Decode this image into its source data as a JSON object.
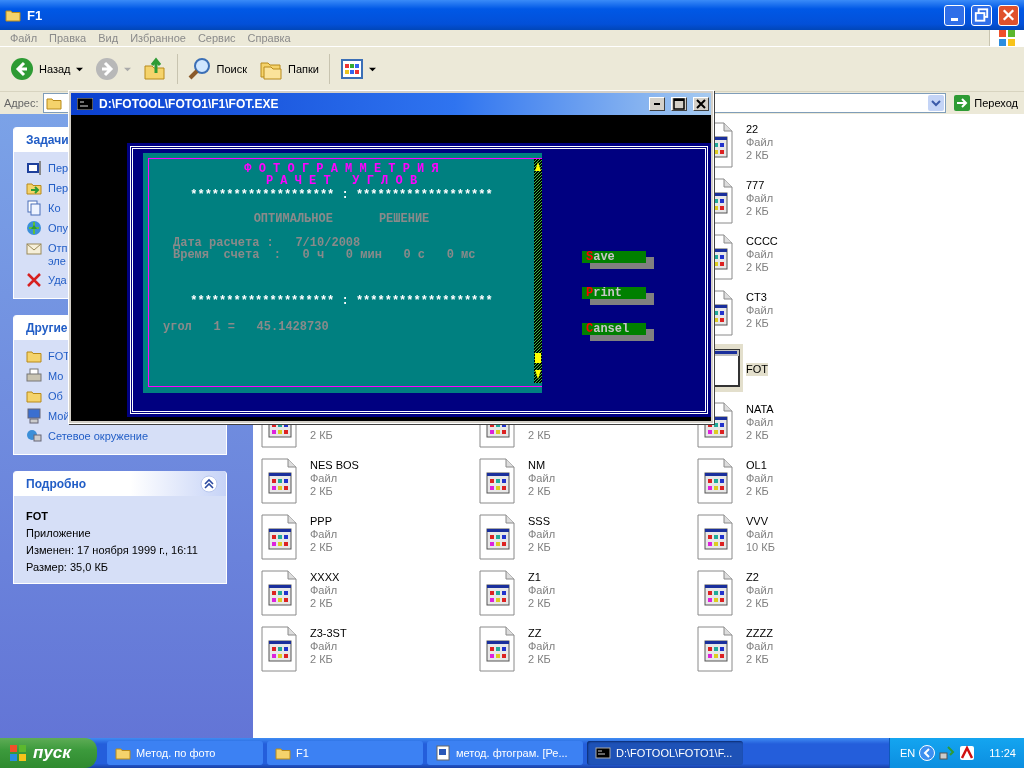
{
  "window": {
    "title": "F1"
  },
  "menu": [
    "Файл",
    "Правка",
    "Вид",
    "Избранное",
    "Сервис",
    "Справка"
  ],
  "toolbar": [
    {
      "kind": "back",
      "label": "Назад",
      "disabled": false
    },
    {
      "kind": "forward",
      "disabled": true
    },
    {
      "kind": "up"
    },
    {
      "kind": "search",
      "label": "Поиск"
    },
    {
      "kind": "folders",
      "label": "Папки"
    },
    {
      "kind": "views"
    }
  ],
  "address": {
    "label": "Адрес:",
    "go": "Переход"
  },
  "sidebar": {
    "panels": [
      {
        "kind": "list",
        "title": "Задачи",
        "items": [
          {
            "kind": "window",
            "lines": [
              "Пер"
            ]
          },
          {
            "kind": "move",
            "lines": [
              "Пер"
            ]
          },
          {
            "kind": "copy",
            "lines": [
              "Ко"
            ]
          },
          {
            "kind": "globe",
            "lines": [
              "Опу"
            ]
          },
          {
            "kind": "mail",
            "lines": [
              "Отп",
              "эле"
            ]
          },
          {
            "kind": "delete",
            "lines": [
              "Уда"
            ]
          }
        ]
      },
      {
        "kind": "list",
        "title": "Другие",
        "items": [
          {
            "kind": "folder",
            "lines": [
              "FOT"
            ]
          },
          {
            "kind": "printer",
            "lines": [
              "Мо"
            ]
          },
          {
            "kind": "folder",
            "lines": [
              "Об"
            ]
          },
          {
            "kind": "computer",
            "lines": [
              "Мой"
            ]
          },
          {
            "kind": "network",
            "lines": [
              "Сетевое окружение"
            ]
          }
        ]
      },
      {
        "kind": "details",
        "title": "Подробно",
        "expanded": true,
        "name": "FOT",
        "lines": [
          "Приложение",
          "Изменен: 17 ноября 1999 г., 16:11",
          "Размер: 35,0 КБ"
        ]
      }
    ]
  },
  "files": {
    "columns": [
      {
        "items": [
          {
            "kind": "file",
            "size": "2 КБ",
            "selected": false
          },
          {
            "kind": "file",
            "name": "NES BOS",
            "type": "Файл",
            "size": "2 КБ",
            "selected": false
          },
          {
            "kind": "file",
            "name": "PPP",
            "type": "Файл",
            "size": "2 КБ",
            "selected": false
          },
          {
            "kind": "file",
            "name": "XXXX",
            "type": "Файл",
            "size": "2 КБ",
            "selected": false
          },
          {
            "kind": "file",
            "name": "Z3-3ST",
            "type": "Файл",
            "size": "2 КБ",
            "selected": false
          }
        ]
      },
      {
        "items": [
          {
            "kind": "file",
            "size": "2 КБ",
            "selected": false
          },
          {
            "kind": "file",
            "name": "NM",
            "type": "Файл",
            "size": "2 КБ",
            "selected": false
          },
          {
            "kind": "file",
            "name": "SSS",
            "type": "Файл",
            "size": "2 КБ",
            "selected": false
          },
          {
            "kind": "file",
            "name": "Z1",
            "type": "Файл",
            "size": "2 КБ",
            "selected": false
          },
          {
            "kind": "file",
            "name": "ZZ",
            "type": "Файл",
            "size": "2 КБ",
            "selected": false
          }
        ]
      },
      {
        "items": [
          {
            "kind": "file",
            "name": "22",
            "type": "Файл",
            "size": "2 КБ",
            "selected": false
          },
          {
            "kind": "file",
            "name": "777",
            "type": "Файл",
            "size": "2 КБ",
            "selected": false
          },
          {
            "kind": "file",
            "name": "CCCC",
            "type": "Файл",
            "size": "2 КБ",
            "selected": false
          },
          {
            "kind": "file",
            "name": "CT3",
            "type": "Файл",
            "size": "2 КБ",
            "selected": false
          },
          {
            "kind": "app",
            "name": "FOT",
            "selected": true
          },
          {
            "kind": "file",
            "name": "NATA",
            "type": "Файл",
            "size": "2 КБ",
            "selected": false
          },
          {
            "kind": "file",
            "name": "OL1",
            "type": "Файл",
            "size": "2 КБ",
            "selected": false
          },
          {
            "kind": "file",
            "name": "VVV",
            "type": "Файл",
            "size": "10 КБ",
            "selected": false
          },
          {
            "kind": "file",
            "name": "Z2",
            "type": "Файл",
            "size": "2 КБ",
            "selected": false
          },
          {
            "kind": "file",
            "name": "ZZZZ",
            "type": "Файл",
            "size": "2 КБ",
            "selected": false
          }
        ]
      }
    ]
  },
  "console": {
    "title": "D:\\FOTOOL\\FOTO1\\F1\\FOT.EXE",
    "heading": [
      "Ф О Т О Г Р А М М Е Т Р И Я",
      "Р А Ч Е Т   У Г Л О В"
    ],
    "rule_top": "******************** : *******************",
    "subtitle": [
      "ОПТИМАЛЬНОЕ",
      "РЕШЕНИЕ"
    ],
    "info": [
      "Дата расчета :   7/10/2008",
      "Время  счета  :   0 ч   0 мин   0 с   0 мс"
    ],
    "rule_bottom": "******************** : *******************",
    "result": "угол   1 =   45.1428730",
    "buttons": [
      {
        "hotkey": "S",
        "rest": "ave"
      },
      {
        "hotkey": "P",
        "rest": "rint"
      },
      {
        "hotkey": "C",
        "rest": "ansel"
      }
    ]
  },
  "taskbar": {
    "start": "пуск",
    "tasks": [
      {
        "kind": "folder",
        "label": "Метод. по фото",
        "selected": false
      },
      {
        "kind": "folder",
        "label": "F1",
        "selected": false
      },
      {
        "kind": "document",
        "label": "метод. фтограм. [Ре...",
        "selected": false
      },
      {
        "kind": "console",
        "label": "D:\\FOTOOL\\FOTO1\\F...",
        "selected": true
      }
    ],
    "language": "EN",
    "time": "11:24"
  }
}
